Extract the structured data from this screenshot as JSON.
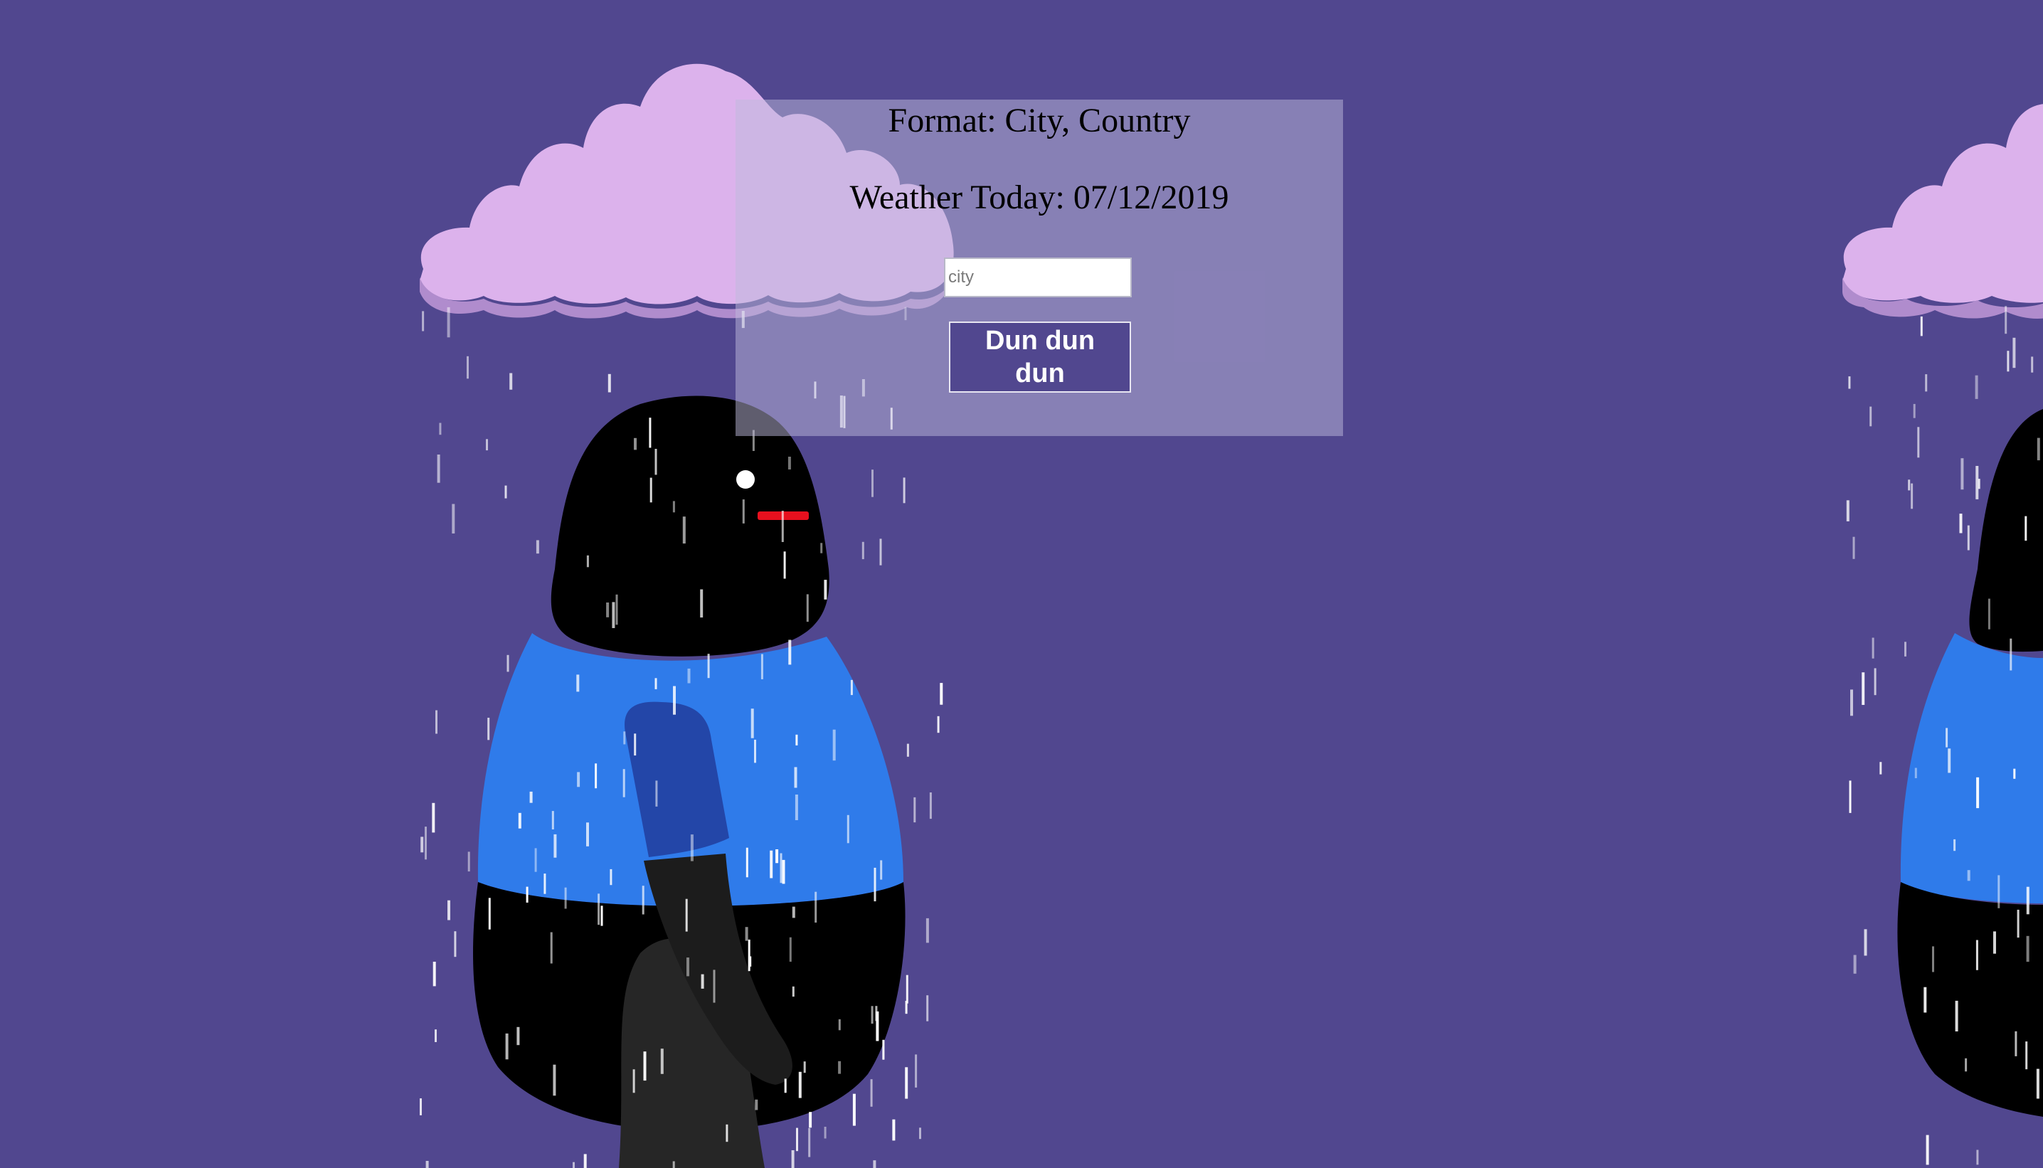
{
  "page": {
    "background_color": "#51478f"
  },
  "panel": {
    "format_heading": "Format: City, Country",
    "weather_heading": "Weather Today: 07/12/2019",
    "city_placeholder": "city",
    "city_value": "",
    "submit_label": "Dun dun dun"
  },
  "illustration": {
    "cloud_color": "#dcb2ec",
    "cloud_shadow_color": "#b08ccd",
    "shirt_color": "#2f7bea",
    "arm_color": "#2346a8",
    "beak_color": "#e8101e",
    "eye_color": "#ffffff",
    "body_color": "#000000",
    "rain_color": "#ffffff"
  }
}
